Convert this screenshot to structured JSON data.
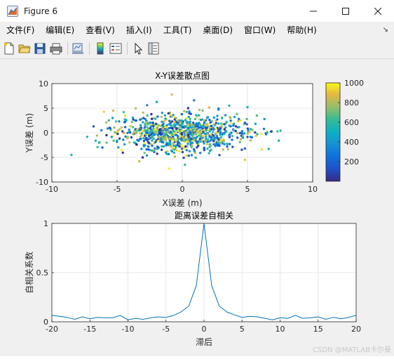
{
  "window": {
    "title": "Figure 6"
  },
  "menu": {
    "items": [
      "文件(F)",
      "编辑(E)",
      "查看(V)",
      "插入(I)",
      "工具(T)",
      "桌面(D)",
      "窗口(W)",
      "帮助(H)"
    ],
    "overflow_arrow": "↘"
  },
  "toolbar": {
    "icons": [
      "new-file-icon",
      "open-folder-icon",
      "save-icon",
      "print-icon",
      "link-figure-icon",
      "colorbar-icon",
      "legend-icon",
      "pointer-icon",
      "property-inspector-icon"
    ]
  },
  "watermark": "CSDN @MATLAB卡尔曼",
  "chart_data": [
    {
      "type": "scatter",
      "title": "X-Y误差散点图",
      "xlabel": "X误差 (m)",
      "ylabel": "Y误差 (m)",
      "xlim": [
        -10,
        10
      ],
      "ylim": [
        -10,
        10
      ],
      "xticks": [
        -10,
        -5,
        0,
        5,
        10
      ],
      "yticks": [
        -10,
        -5,
        0,
        5,
        10
      ],
      "grid": true,
      "colormap": "parula",
      "color_range": [
        0,
        1000
      ],
      "colorbar": {
        "ticks": [
          200,
          400,
          600,
          800,
          1000
        ],
        "placement": "right"
      },
      "point_count": 1000,
      "distribution": {
        "x_mean": 0,
        "x_std": 2.5,
        "y_mean": 0,
        "y_std": 1.8,
        "color": "sample index 1–1000"
      },
      "points": [
        {
          "x": -8.5,
          "y": -4.5,
          "c": 560
        },
        {
          "x": -6.8,
          "y": 1.3,
          "c": 120
        },
        {
          "x": -6.5,
          "y": -2.9,
          "c": 610
        },
        {
          "x": -6.0,
          "y": 4.3,
          "c": 930
        },
        {
          "x": -5.8,
          "y": -2.0,
          "c": 700
        },
        {
          "x": -5.3,
          "y": 4.5,
          "c": 880
        },
        {
          "x": -3.3,
          "y": -5.8,
          "c": 830
        },
        {
          "x": -2.7,
          "y": 5.6,
          "c": 350
        },
        {
          "x": -0.8,
          "y": 7.8,
          "c": 880
        },
        {
          "x": 0.2,
          "y": -6.5,
          "c": 620
        },
        {
          "x": -1.0,
          "y": -7.3,
          "c": 980
        },
        {
          "x": 0.9,
          "y": 6.6,
          "c": 300
        },
        {
          "x": 3.6,
          "y": 5.5,
          "c": 580
        },
        {
          "x": 5.0,
          "y": 5.2,
          "c": 520
        },
        {
          "x": 4.8,
          "y": -5.5,
          "c": 900
        },
        {
          "x": 4.8,
          "y": -3.2,
          "c": 160
        },
        {
          "x": 6.3,
          "y": 2.8,
          "c": 440
        },
        {
          "x": 7.4,
          "y": -1.6,
          "c": 510
        },
        {
          "x": 7.3,
          "y": 0.3,
          "c": 640
        },
        {
          "x": 6.1,
          "y": -3.4,
          "c": 940
        }
      ]
    },
    {
      "type": "line",
      "title": "距离误差自相关",
      "xlabel": "滞后",
      "ylabel": "自相关系数",
      "xlim": [
        -20,
        20
      ],
      "ylim": [
        0,
        1
      ],
      "xticks": [
        -20,
        -15,
        -10,
        -5,
        0,
        5,
        10,
        15,
        20
      ],
      "yticks": [
        0,
        0.5,
        1
      ],
      "grid": true,
      "color": "#0072BD",
      "x": [
        -20,
        -19,
        -18,
        -17,
        -16,
        -15,
        -14,
        -13,
        -12,
        -11,
        -10,
        -9,
        -8,
        -7,
        -6,
        -5,
        -4,
        -3,
        -2,
        -1,
        0,
        1,
        2,
        3,
        4,
        5,
        6,
        7,
        8,
        9,
        10,
        11,
        12,
        13,
        14,
        15,
        16,
        17,
        18,
        19,
        20
      ],
      "y": [
        0.065,
        0.055,
        0.045,
        0.025,
        0.05,
        0.03,
        0.045,
        0.04,
        0.04,
        0.065,
        0.02,
        0.035,
        0.025,
        0.04,
        0.05,
        0.045,
        0.065,
        0.1,
        0.16,
        0.37,
        1.0,
        0.37,
        0.16,
        0.1,
        0.07,
        0.045,
        0.055,
        0.05,
        0.035,
        0.02,
        0.04,
        0.035,
        0.065,
        0.035,
        0.04,
        0.05,
        0.025,
        0.045,
        0.03,
        0.045,
        0.065
      ]
    }
  ]
}
